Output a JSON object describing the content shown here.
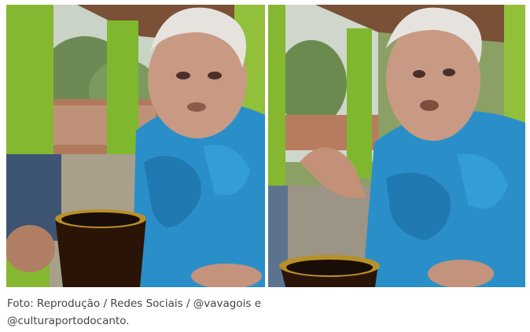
{
  "caption": {
    "line1": "Foto: Reprodução / Redes Sociais / @vavagois e",
    "line2": "@culturaportodocanto."
  },
  "colors": {
    "wall_green": "#7fb82e",
    "blouse_blue": "#2a8fc9",
    "coffee": "#1a0c06",
    "caption_text": "#444444"
  }
}
